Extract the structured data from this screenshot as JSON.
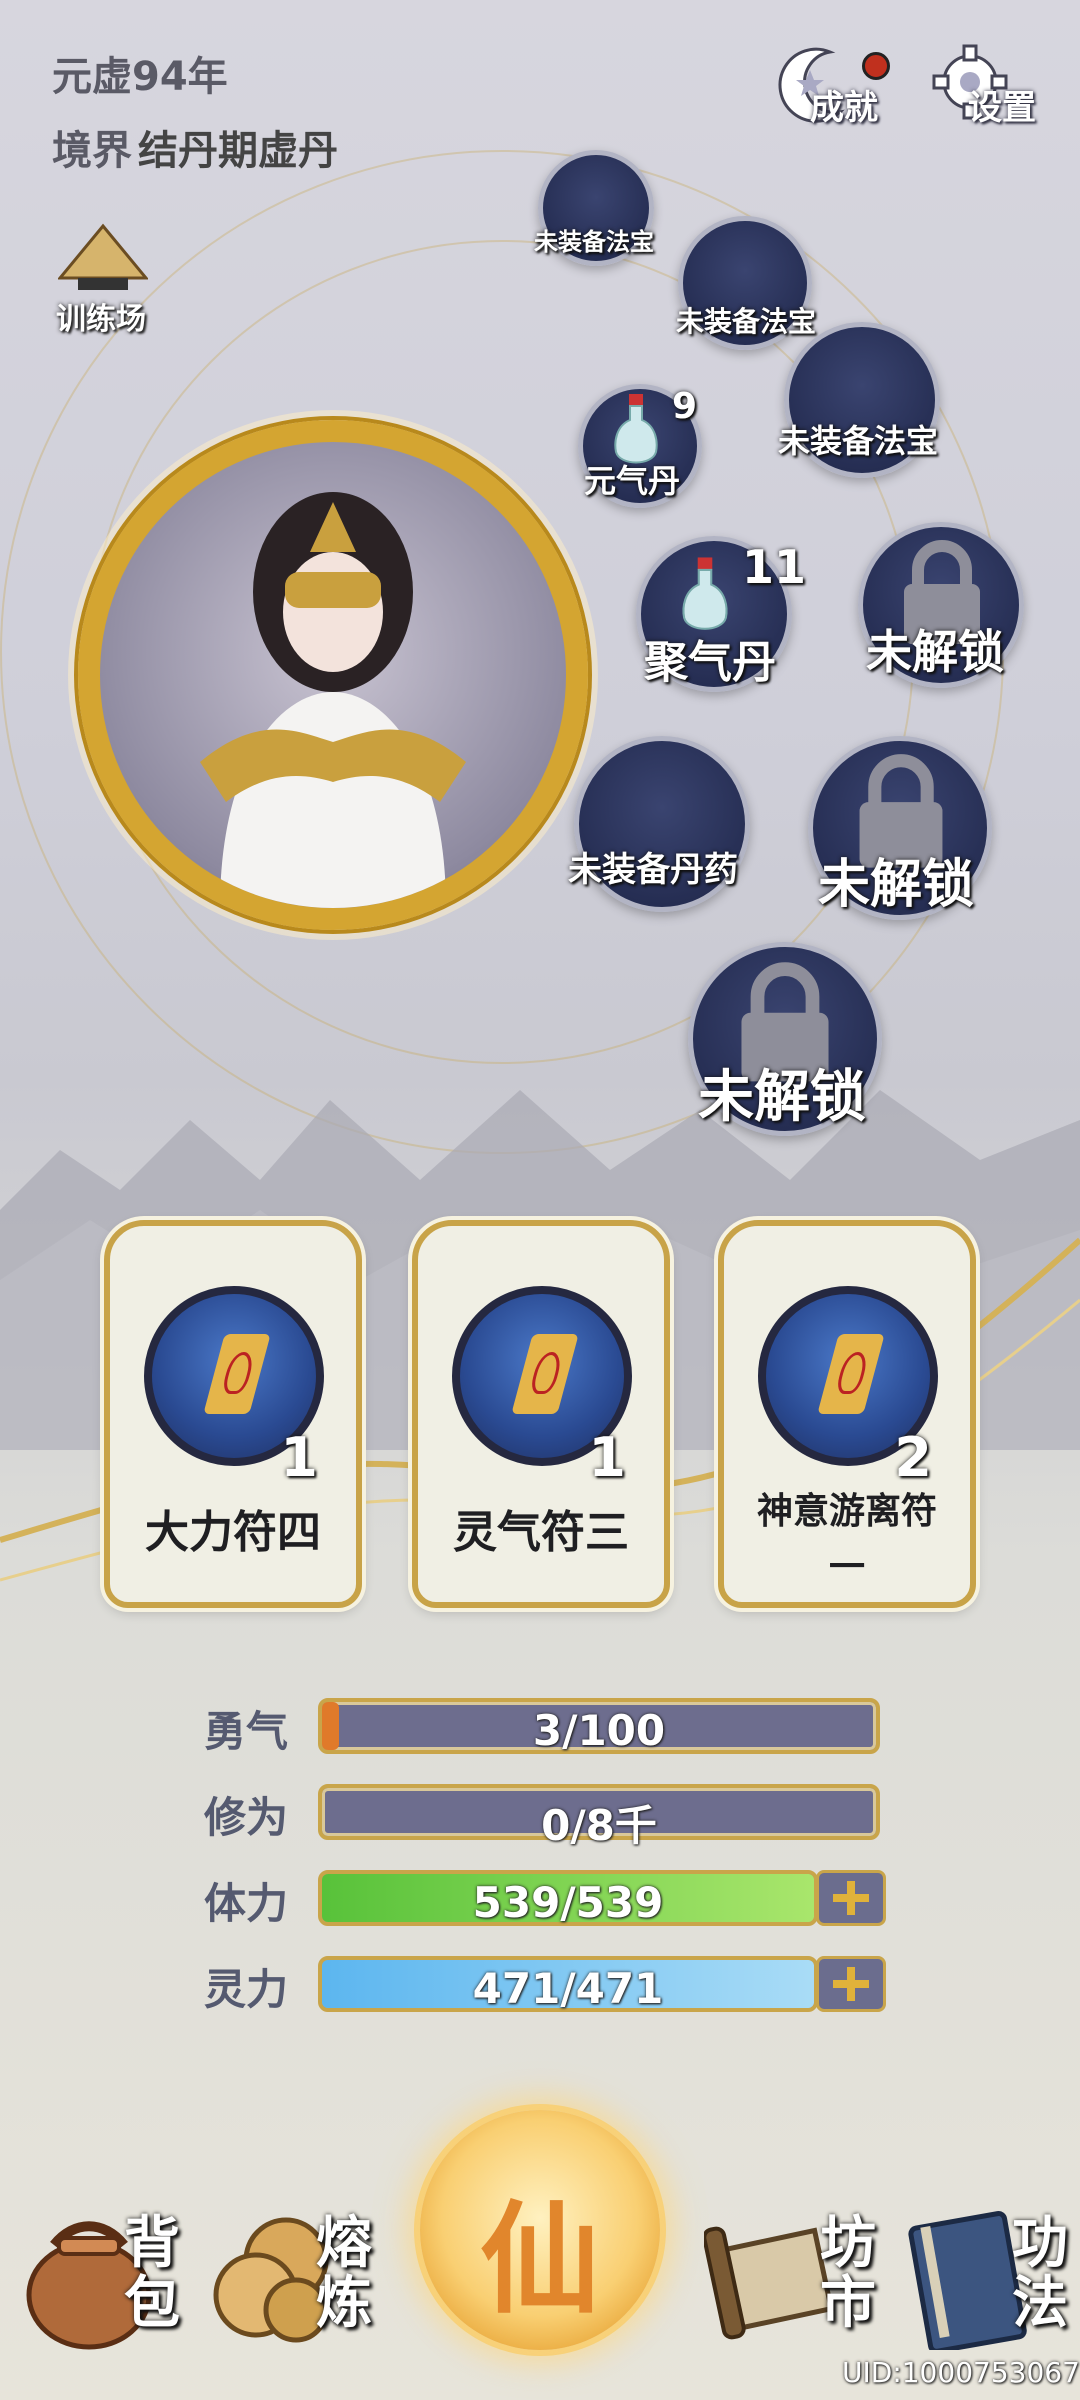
{
  "header": {
    "year": "元虚94年",
    "realm_label": "境界",
    "realm_value": "结丹期虚丹"
  },
  "top_buttons": {
    "achievements": "成就",
    "settings": "设置"
  },
  "training": {
    "label": "训练场"
  },
  "slots": {
    "artifact1": "未装备法宝",
    "artifact2": "未装备法宝",
    "artifact3": "未装备法宝",
    "pill_yuanqi": {
      "name": "元气丹",
      "count": "9"
    },
    "pill_juqi": {
      "name": "聚气丹",
      "count": "11"
    },
    "locked1": "未解锁",
    "pill_empty": "未装备丹药",
    "locked2": "未解锁",
    "locked3": "未解锁"
  },
  "cards": [
    {
      "name": "大力符四",
      "count": "1"
    },
    {
      "name": "灵气符三",
      "count": "1"
    },
    {
      "name": "神意游离符一",
      "count": "2"
    }
  ],
  "stats": {
    "courage": {
      "label": "勇气",
      "value": "3/100",
      "fill": 0.03
    },
    "cultivation": {
      "label": "修为",
      "value": "0/8千",
      "fill": 0.0
    },
    "stamina": {
      "label": "体力",
      "value": "539/539",
      "fill": 1.0
    },
    "spirit": {
      "label": "灵力",
      "value": "471/471",
      "fill": 1.0
    }
  },
  "nav": {
    "bag": "背包",
    "smelt": "熔炼",
    "center": "仙",
    "market": "坊市",
    "skills": "功法"
  },
  "uid": "UID:1000753067",
  "colors": {
    "gold": "#d4a531",
    "slot": "#252d52",
    "stamina_green": "#8bd74c",
    "spirit_blue": "#7cc6ef"
  }
}
